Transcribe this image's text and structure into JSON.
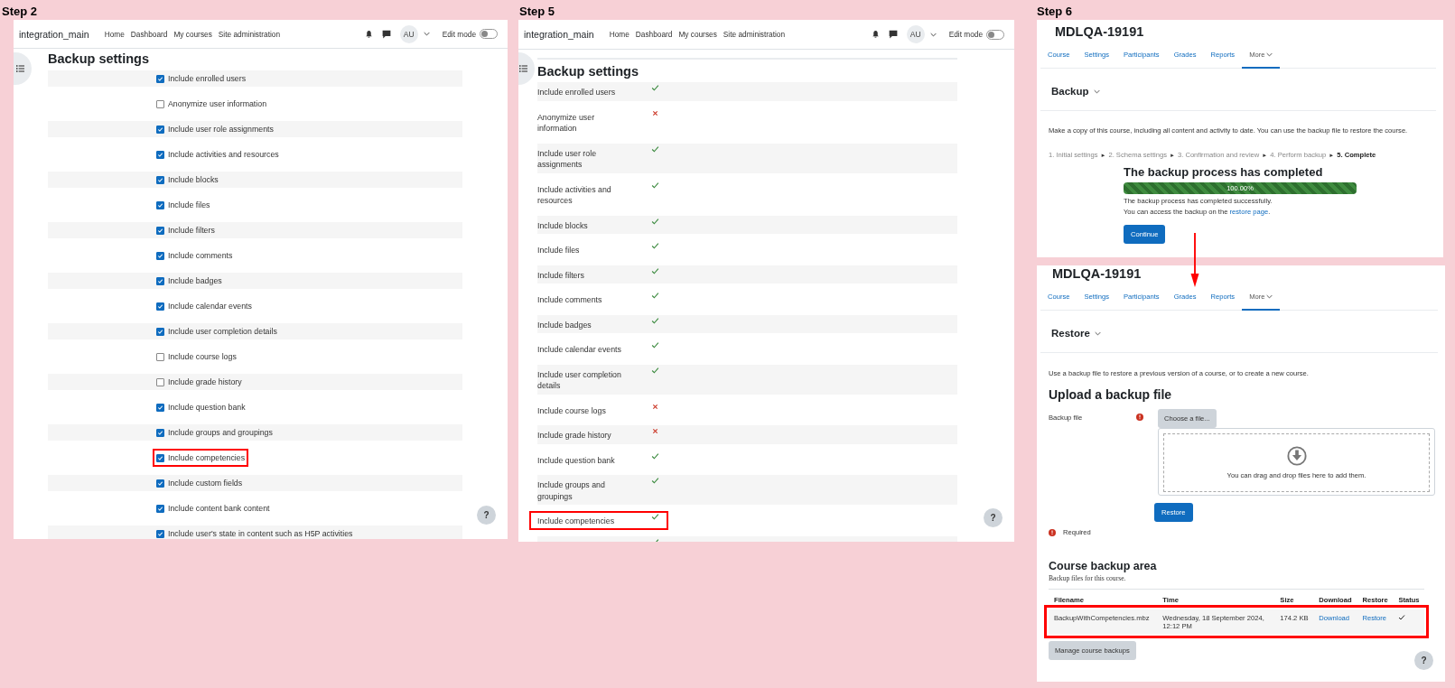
{
  "panels": [
    {
      "kind": "settings_form",
      "step_label": "Step 2",
      "site_name": "integration_main",
      "nav": [
        "Home",
        "Dashboard",
        "My courses",
        "Site administration"
      ],
      "user_initials": "AU",
      "edit_mode": {
        "label": "Edit mode",
        "on": false
      },
      "heading": "Backup settings",
      "help_label": "?",
      "settings": [
        {
          "label": "Include enrolled users",
          "checked": true,
          "highlighted": false
        },
        {
          "label": "Anonymize user information",
          "checked": false,
          "highlighted": false
        },
        {
          "label": "Include user role assignments",
          "checked": true,
          "highlighted": false
        },
        {
          "label": "Include activities and resources",
          "checked": true,
          "highlighted": false
        },
        {
          "label": "Include blocks",
          "checked": true,
          "highlighted": false
        },
        {
          "label": "Include files",
          "checked": true,
          "highlighted": false
        },
        {
          "label": "Include filters",
          "checked": true,
          "highlighted": false
        },
        {
          "label": "Include comments",
          "checked": true,
          "highlighted": false
        },
        {
          "label": "Include badges",
          "checked": true,
          "highlighted": false
        },
        {
          "label": "Include calendar events",
          "checked": true,
          "highlighted": false
        },
        {
          "label": "Include user completion details",
          "checked": true,
          "highlighted": false
        },
        {
          "label": "Include course logs",
          "checked": false,
          "highlighted": false
        },
        {
          "label": "Include grade history",
          "checked": false,
          "highlighted": false
        },
        {
          "label": "Include question bank",
          "checked": true,
          "highlighted": false
        },
        {
          "label": "Include groups and groupings",
          "checked": true,
          "highlighted": false
        },
        {
          "label": "Include competencies",
          "checked": true,
          "highlighted": true
        },
        {
          "label": "Include custom fields",
          "checked": true,
          "highlighted": false
        },
        {
          "label": "Include content bank content",
          "checked": true,
          "highlighted": false
        },
        {
          "label": "Include user's state in content such as H5P activities",
          "checked": true,
          "highlighted": false
        }
      ]
    },
    {
      "kind": "settings_review",
      "step_label": "Step 5",
      "site_name": "integration_main",
      "nav": [
        "Home",
        "Dashboard",
        "My courses",
        "Site administration"
      ],
      "user_initials": "AU",
      "edit_mode": {
        "label": "Edit mode",
        "on": false
      },
      "heading": "Backup settings",
      "help_label": "?",
      "settings": [
        {
          "label": "Include enrolled users",
          "included": true,
          "highlighted": false
        },
        {
          "label": "Anonymize user information",
          "included": false,
          "highlighted": false
        },
        {
          "label": "Include user role assignments",
          "included": true,
          "highlighted": false
        },
        {
          "label": "Include activities and resources",
          "included": true,
          "highlighted": false
        },
        {
          "label": "Include blocks",
          "included": true,
          "highlighted": false
        },
        {
          "label": "Include files",
          "included": true,
          "highlighted": false
        },
        {
          "label": "Include filters",
          "included": true,
          "highlighted": false
        },
        {
          "label": "Include comments",
          "included": true,
          "highlighted": false
        },
        {
          "label": "Include badges",
          "included": true,
          "highlighted": false
        },
        {
          "label": "Include calendar events",
          "included": true,
          "highlighted": false
        },
        {
          "label": "Include user completion details",
          "included": true,
          "highlighted": false
        },
        {
          "label": "Include course logs",
          "included": false,
          "highlighted": false
        },
        {
          "label": "Include grade history",
          "included": false,
          "highlighted": false
        },
        {
          "label": "Include question bank",
          "included": true,
          "highlighted": false
        },
        {
          "label": "Include groups and groupings",
          "included": true,
          "highlighted": false
        },
        {
          "label": "Include competencies",
          "included": true,
          "highlighted": true
        },
        {
          "included": true,
          "highlighted": false
        }
      ]
    },
    {
      "kind": "course_pages",
      "step_label": "Step 6",
      "pages": [
        {
          "kind": "backup",
          "course_title": "MDLQA-19191",
          "tabs": [
            {
              "label": "Course",
              "selected": false
            },
            {
              "label": "Settings",
              "selected": false
            },
            {
              "label": "Participants",
              "selected": false
            },
            {
              "label": "Grades",
              "selected": false
            },
            {
              "label": "Reports",
              "selected": false
            },
            {
              "label": "More",
              "selected": true
            }
          ],
          "page_menu": "Backup",
          "description": "Make a copy of this course, including all content and activity to date. You can use the backup file to restore the course.",
          "stage_separator": "►",
          "stages": [
            {
              "label": "1. Initial settings",
              "selected": false
            },
            {
              "label": "2. Schema settings",
              "selected": false
            },
            {
              "label": "3. Confirmation and review",
              "selected": false
            },
            {
              "label": "4. Perform backup",
              "selected": false
            },
            {
              "label": "5. Complete",
              "selected": true
            }
          ],
          "result": {
            "heading": "The backup process has completed",
            "progress": {
              "level": 1,
              "label": "100.00%"
            },
            "message": "The backup process has completed successfully.",
            "access": {
              "text": "You can access the backup on the",
              "link": "restore page",
              "end": "."
            },
            "button": "Continue"
          }
        },
        {
          "kind": "restore",
          "course_title": "MDLQA-19191",
          "tabs": [
            {
              "label": "Course",
              "selected": false
            },
            {
              "label": "Settings",
              "selected": false
            },
            {
              "label": "Participants",
              "selected": false
            },
            {
              "label": "Grades",
              "selected": false
            },
            {
              "label": "Reports",
              "selected": false
            },
            {
              "label": "More",
              "selected": true
            }
          ],
          "page_menu": "Restore",
          "intro": "Use a backup file to restore a previous version of a course, or to create a new course.",
          "upload": {
            "heading": "Upload a backup file",
            "field_label": "Backup file",
            "required": true,
            "choose_button": "Choose a file...",
            "drop_hint": "You can drag and drop files here to add them.",
            "submit": "Restore",
            "required_note": "Required"
          },
          "backup_area": {
            "heading": "Course backup area",
            "subtitle": "Backup files for this course.",
            "columns": [
              "Filename",
              "Time",
              "Size",
              "Download",
              "Restore",
              "Status"
            ],
            "rows": [
              {
                "filename": "BackupWithCompetencies.mbz",
                "time": "Wednesday, 18 September 2024, 12:12 PM",
                "size": "174.2 KB",
                "download": "Download",
                "restore": "Restore",
                "status_ok": true,
                "highlighted": true
              }
            ],
            "manage_button": "Manage course backups"
          },
          "help_label": "?"
        }
      ]
    }
  ]
}
